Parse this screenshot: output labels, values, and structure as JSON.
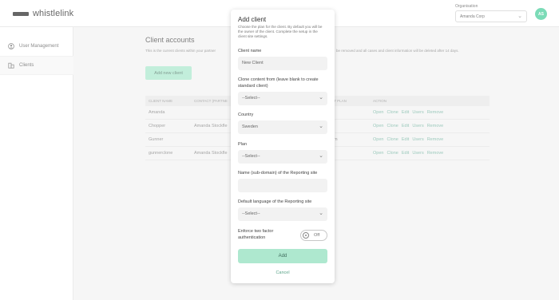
{
  "app": {
    "logo_text": "whistlelink"
  },
  "header": {
    "org_label": "Organisation",
    "org_value": "Amanda Corp",
    "avatar_initials": "AS"
  },
  "sidebar": {
    "items": [
      {
        "label": "User Management",
        "icon": "user-circle-icon"
      },
      {
        "label": "Clients",
        "icon": "building-icon"
      }
    ]
  },
  "main": {
    "title": "Client accounts",
    "description_left": "This is the current clients within your partner",
    "description_right": "be removed and all cases and client information will be deleted after 14 days.",
    "add_new_label": "Add new client",
    "table": {
      "headers": [
        "CLIENT NAME",
        "CONTACT (PARTNE",
        "NT PLAN",
        "ACTION"
      ],
      "rows": [
        {
          "name": "Amanda",
          "contact": "",
          "plan": ""
        },
        {
          "name": "Chopper",
          "contact": "Amanda Stockfle",
          "plan": ""
        },
        {
          "name": "Gunner",
          "contact": "",
          "plan": "um"
        },
        {
          "name": "gunnerclone",
          "contact": "Amanda Stockfle",
          "plan": ""
        }
      ],
      "actions": [
        "Open",
        "Clone",
        "Edit",
        "Users",
        "Remove"
      ]
    }
  },
  "modal": {
    "title": "Add client",
    "description": "Choose the plan for the client. By default you will be the owner of the client. Complete the setup in the client site settings.",
    "client_name_label": "Client name",
    "client_name_placeholder": "New Client",
    "clone_label": "Clone content from (leave blank to create standard client)",
    "clone_value": "--Select--",
    "country_label": "Country",
    "country_value": "Sweden",
    "plan_label": "Plan",
    "plan_value": "--Select--",
    "subdomain_label": "Name (sub-domain) of the Reporting site",
    "subdomain_value": "",
    "language_label": "Default language of the Reporting site",
    "language_value": "--Select--",
    "twofactor_label": "Enforce two factor authentication",
    "twofactor_state": "Off",
    "add_label": "Add",
    "cancel_label": "Cancel"
  },
  "colors": {
    "accent": "#aee8cf",
    "avatar": "#4fcf9f",
    "link": "#5da58b"
  }
}
